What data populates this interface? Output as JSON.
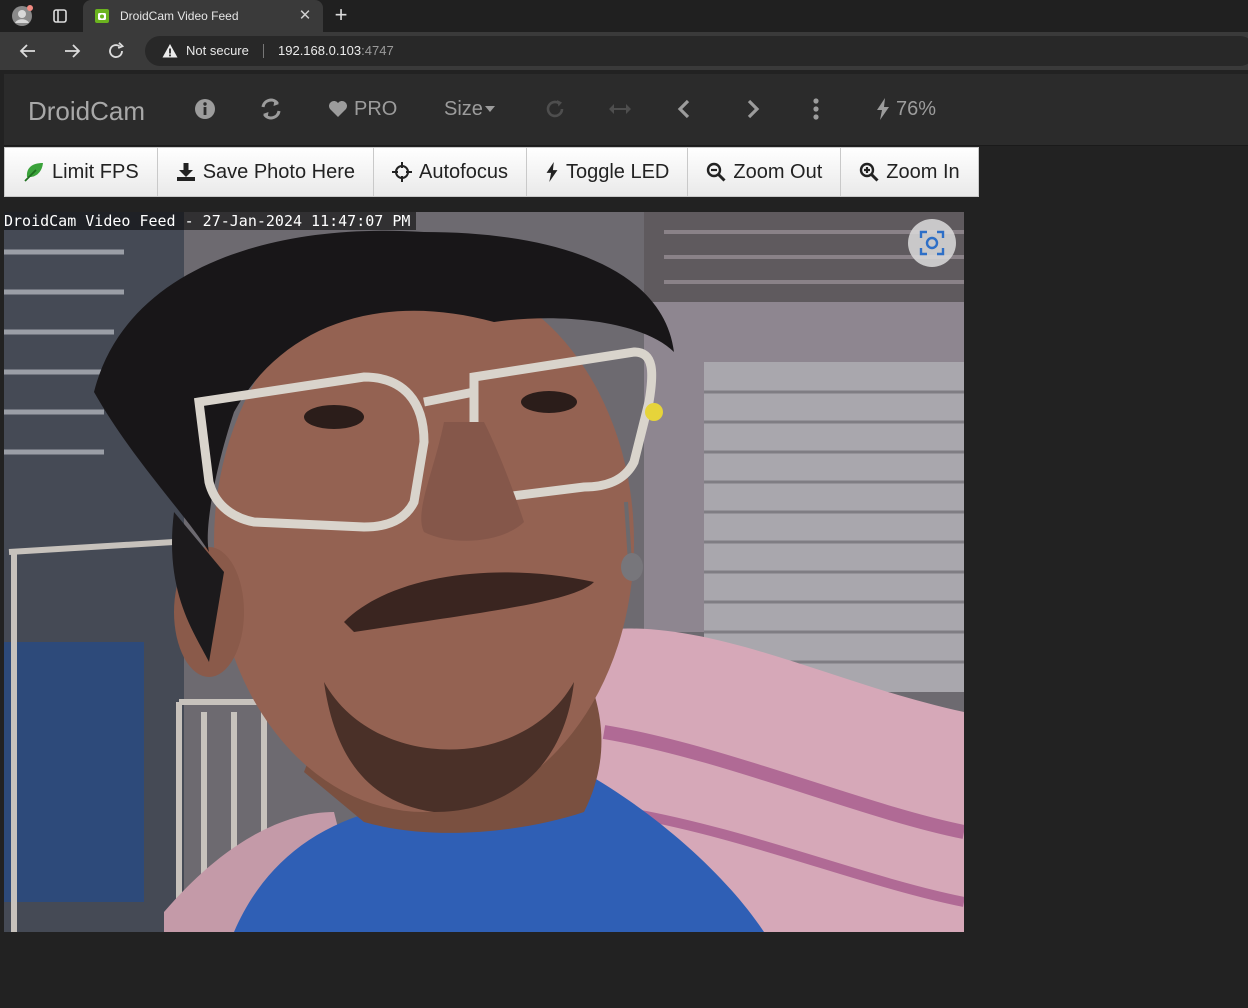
{
  "browser": {
    "tab_title": "DroidCam Video Feed",
    "tab_close_icon": "close-icon",
    "new_tab_icon": "plus-icon",
    "security_label": "Not secure",
    "url_host": "192.168.0.103",
    "url_port": ":4747"
  },
  "navbar": {
    "brand": "DroidCam",
    "info_icon": "info-icon",
    "refresh_icon": "refresh-icon",
    "pro_label": "PRO",
    "size_label": "Size",
    "battery": "76%"
  },
  "buttons": [
    {
      "label": "Limit FPS",
      "icon": "leaf-icon"
    },
    {
      "label": "Save Photo Here",
      "icon": "download-icon"
    },
    {
      "label": "Autofocus",
      "icon": "crosshair-icon"
    },
    {
      "label": "Toggle LED",
      "icon": "bolt-icon"
    },
    {
      "label": "Zoom Out",
      "icon": "zoom-out-icon"
    },
    {
      "label": "Zoom In",
      "icon": "zoom-in-icon"
    }
  ],
  "video": {
    "overlay": "DroidCam Video Feed - 27-Jan-2024 11:47:07 PM"
  },
  "colors": {
    "page_bg": "#222222",
    "navbar_bg": "#2b2b2b",
    "leaf_green": "#3aa23a"
  }
}
